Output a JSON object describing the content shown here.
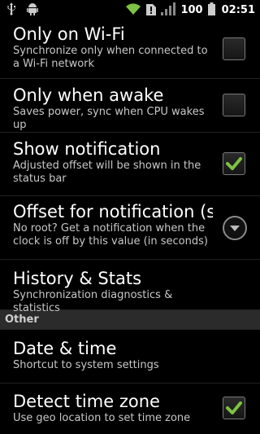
{
  "status_bar": {
    "icons": [
      "usb-icon",
      "android-debug-icon",
      "wifi-icon",
      "alert-icon",
      "signal-icon",
      "battery-icon"
    ],
    "battery_level": "100",
    "time": "02:51"
  },
  "preferences": [
    {
      "title": "Only on Wi-Fi",
      "summary": "Synchronize only when connected to a Wi-Fi network",
      "widget": "checkbox",
      "checked": false
    },
    {
      "title": "Only when awake",
      "summary": "Saves power, sync when CPU wakes up",
      "widget": "checkbox",
      "checked": false
    },
    {
      "title": "Show notification",
      "summary": "Adjusted offset will be shown in the status bar",
      "widget": "checkbox",
      "checked": true
    },
    {
      "title": "Offset for notification (se",
      "summary": "No root? Get a notification when the clock is off by this value (in seconds)",
      "widget": "dropdown"
    },
    {
      "title": "History & Stats",
      "summary": "Synchronization diagnostics & statistics",
      "widget": "none"
    }
  ],
  "section_other": {
    "header": "Other",
    "items": [
      {
        "title": "Date & time",
        "summary": "Shortcut to system settings",
        "widget": "none"
      },
      {
        "title": "Detect time zone",
        "summary": "Use geo location to set time zone",
        "widget": "checkbox",
        "checked": true
      }
    ]
  },
  "colors": {
    "check_mark": "#7dc242",
    "divider": "#222222",
    "section_bg": "#2b2b2b"
  }
}
